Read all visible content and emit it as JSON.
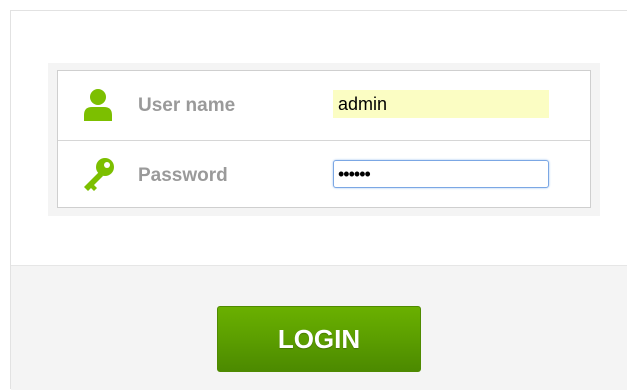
{
  "login_form": {
    "username": {
      "label": "User name",
      "value": "admin",
      "icon": "user-icon"
    },
    "password": {
      "label": "Password",
      "value": "••••••",
      "icon": "key-icon"
    }
  },
  "actions": {
    "login_label": "LOGIN"
  },
  "colors": {
    "icon_green": "#7cbf00",
    "button_green": "#5da000",
    "username_field_bg": "#fbfdc3",
    "focus_border": "#7ba7e4"
  }
}
